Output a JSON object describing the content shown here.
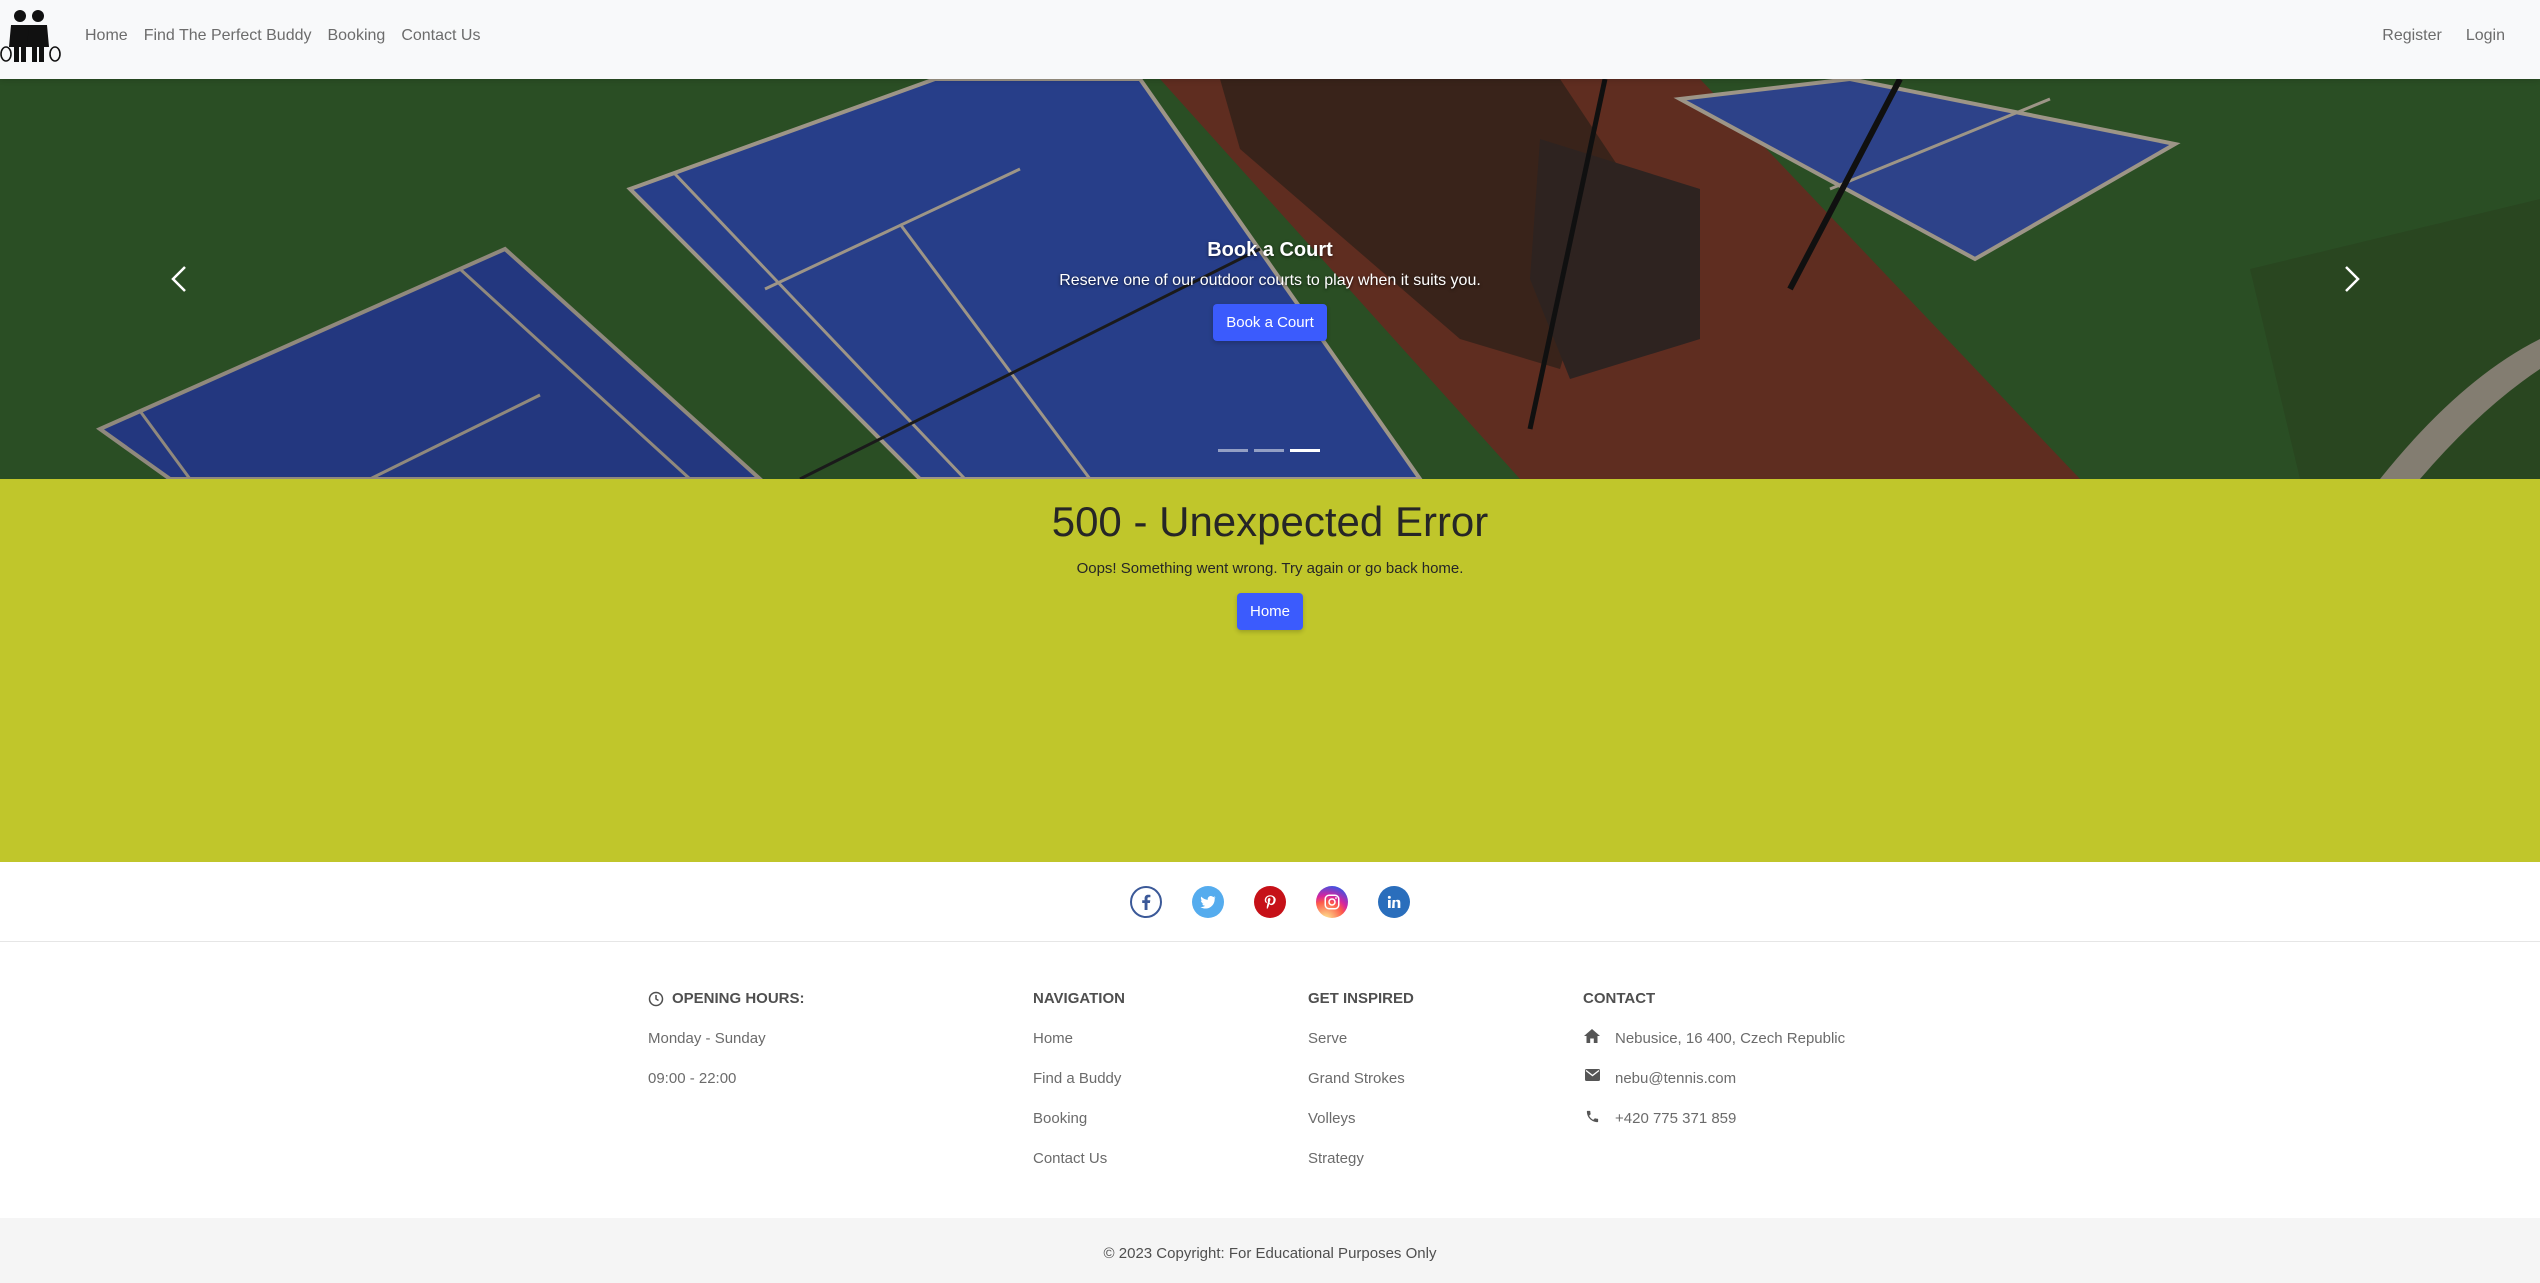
{
  "nav": {
    "links": [
      "Home",
      "Find The Perfect Buddy",
      "Booking",
      "Contact Us"
    ],
    "right_links": [
      "Register",
      "Login"
    ]
  },
  "carousel": {
    "title": "Book a Court",
    "text": "Reserve one of our outdoor courts to play when it suits you.",
    "button_label": "Book a Court",
    "slide_count": 3,
    "active_slide": 3
  },
  "error": {
    "title": "500 - Unexpected Error",
    "text": "Oops! Something went wrong. Try again or go back home.",
    "button_label": "Home"
  },
  "social": [
    {
      "icon": "facebook-icon",
      "color": "#3b5998"
    },
    {
      "icon": "twitter-icon",
      "color": "#55acee"
    },
    {
      "icon": "pinterest-icon",
      "color": "#c61118"
    },
    {
      "icon": "instagram-icon",
      "color": "#ac2bac"
    },
    {
      "icon": "linkedin-icon",
      "color": "#0082ca"
    }
  ],
  "footer": {
    "hours": {
      "heading": "Opening hours:",
      "days": "Monday - Sunday",
      "time": "09:00 - 22:00"
    },
    "navigation": {
      "heading": "Navigation",
      "links": [
        "Home",
        "Find a Buddy",
        "Booking",
        "Contact Us"
      ]
    },
    "inspired": {
      "heading": "Get inspired",
      "links": [
        "Serve",
        "Grand Strokes",
        "Volleys",
        "Strategy"
      ]
    },
    "contact": {
      "heading": "Contact",
      "address": "Nebusice, 16 400, Czech Republic",
      "email": "nebu@tennis.com",
      "phone": "+420 775 371 859"
    },
    "copyright": "© 2023 Copyright: For Educational Purposes Only"
  },
  "colors": {
    "accent": "#3b5bfd",
    "error_bg": "#c0c62b",
    "navbar_bg": "#f8f9fa"
  }
}
